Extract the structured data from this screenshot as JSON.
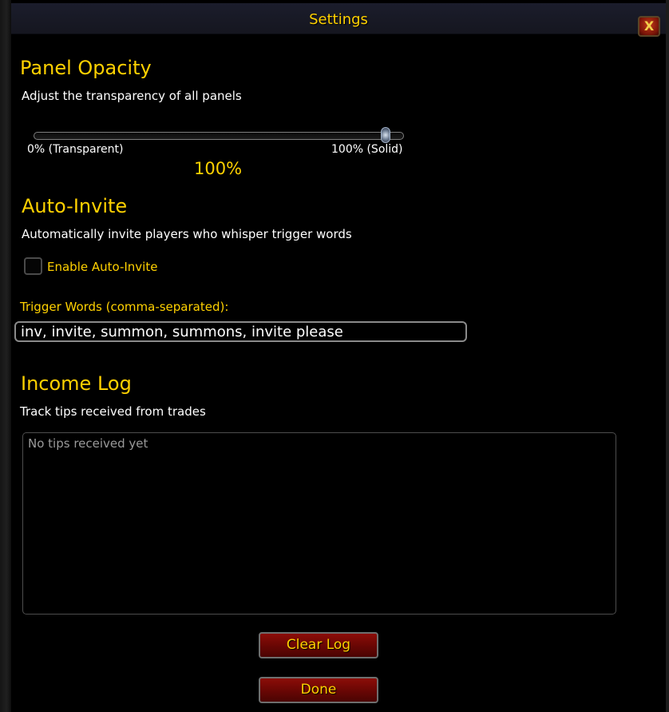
{
  "window": {
    "title": "Settings",
    "close_symbol": "X"
  },
  "panel_opacity": {
    "heading": "Panel Opacity",
    "description": "Adjust the transparency of all panels",
    "min_label": "0% (Transparent)",
    "max_label": "100% (Solid)",
    "value_label": "100%",
    "value_percent": 100
  },
  "auto_invite": {
    "heading": "Auto-Invite",
    "description": "Automatically invite players who whisper trigger words",
    "checkbox_label": "Enable Auto-Invite",
    "checkbox_checked": false,
    "trigger_label": "Trigger Words (comma-separated):",
    "trigger_value": "inv, invite, summon, summons, invite please"
  },
  "income_log": {
    "heading": "Income Log",
    "description": "Track tips received from trades",
    "placeholder": "No tips received yet"
  },
  "buttons": {
    "clear_log": "Clear Log",
    "done": "Done"
  },
  "colors": {
    "accent_gold": "#ffd100",
    "button_red": "#6b0704",
    "background": "#000000"
  }
}
